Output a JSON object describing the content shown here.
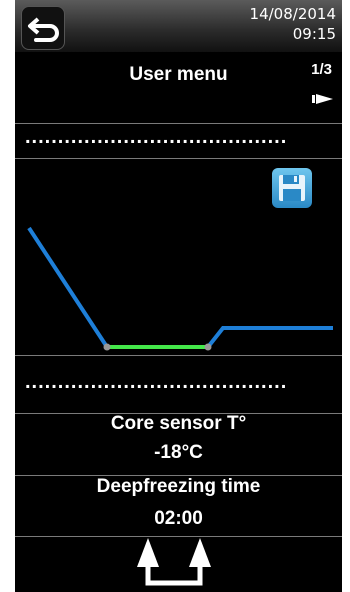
{
  "header": {
    "date": "14/08/2014",
    "time": "09:15"
  },
  "menu": {
    "title": "User menu",
    "page": "1/3"
  },
  "placeholders": {
    "top": "........................................",
    "bottom": "........................................"
  },
  "core_sensor": {
    "label": "Core sensor T°",
    "value": "-18°C"
  },
  "deepfreezing": {
    "label": "Deepfreezing time",
    "value": "02:00"
  },
  "colors": {
    "profile_blue": "#1e7fd8",
    "profile_green": "#44e84a",
    "save_blue": "#3a9ad8"
  }
}
